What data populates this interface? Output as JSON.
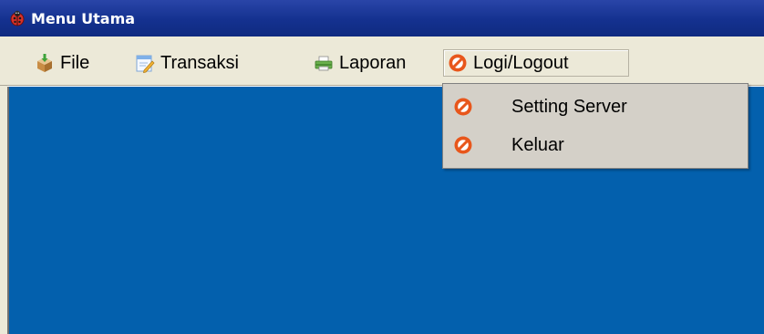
{
  "window": {
    "title": "Menu Utama",
    "app_icon": "ladybug-icon"
  },
  "menubar": {
    "items": [
      {
        "label": "File",
        "icon": "package-icon"
      },
      {
        "label": "Transaksi",
        "icon": "edit-document-icon"
      },
      {
        "label": "Laporan",
        "icon": "printer-icon"
      },
      {
        "label": "Logi/Logout",
        "icon": "no-entry-icon"
      }
    ]
  },
  "dropdown": {
    "items": [
      {
        "label": "Setting Server",
        "icon": "no-entry-icon"
      },
      {
        "label": "Keluar",
        "icon": "no-entry-icon"
      }
    ]
  },
  "colors": {
    "titlebar": "#14318f",
    "menubar": "#ece9d8",
    "desktop": "#0360ad",
    "dropdown": "#d4d0c8",
    "no_entry": "#e8561b"
  }
}
